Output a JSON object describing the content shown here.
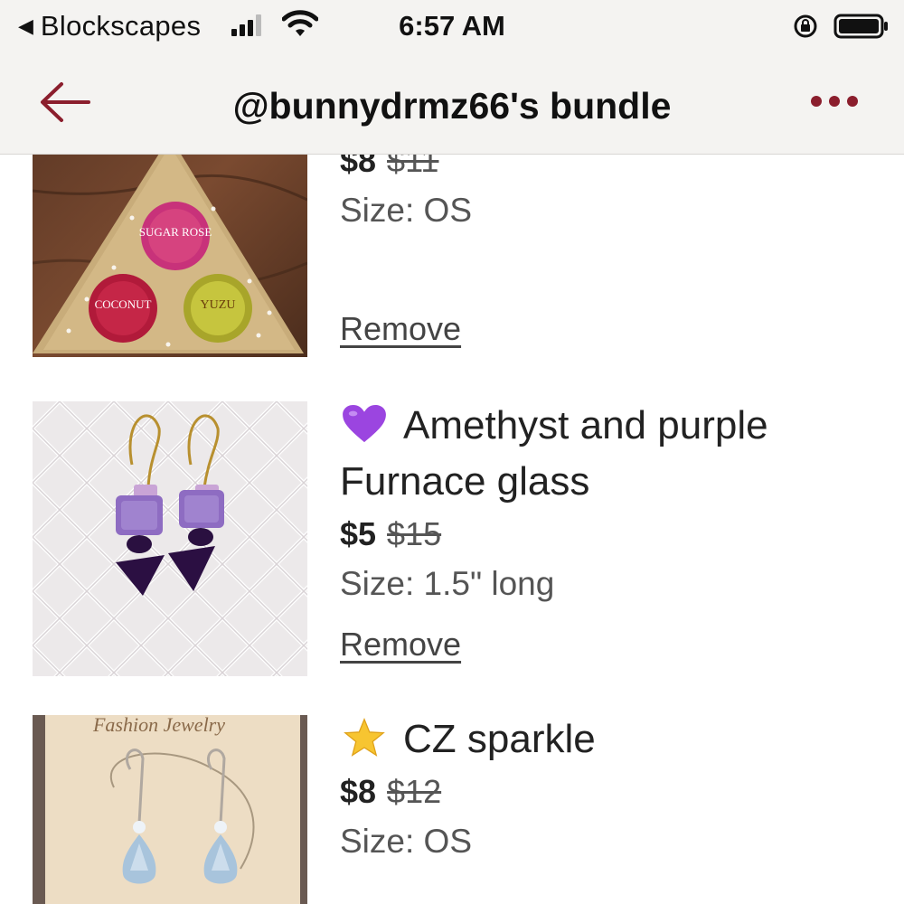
{
  "status_bar": {
    "back_app": "Blockscapes",
    "time": "6:57 AM"
  },
  "header": {
    "title": "@bunnydrmz66's bundle"
  },
  "colors": {
    "accent": "#8b1e2d",
    "header_bg": "#f4f3f1"
  },
  "items": [
    {
      "title": "",
      "price_now": "$8",
      "price_original": "$11",
      "size": "Size: OS",
      "remove_label": "Remove",
      "thumb_logo_text": [
        "SUGAR ROSE",
        "COCONUT",
        "YUZU"
      ]
    },
    {
      "emoji": "purple-heart",
      "title_line1": "Amethyst and purple",
      "title_line2": "Furnace glass",
      "price_now": "$5",
      "price_original": "$15",
      "size": "Size: 1.5\" long",
      "remove_label": "Remove"
    },
    {
      "emoji": "star",
      "title_line1": "CZ sparkle",
      "price_now": "$8",
      "price_original": "$12",
      "size": "Size: OS"
    }
  ]
}
